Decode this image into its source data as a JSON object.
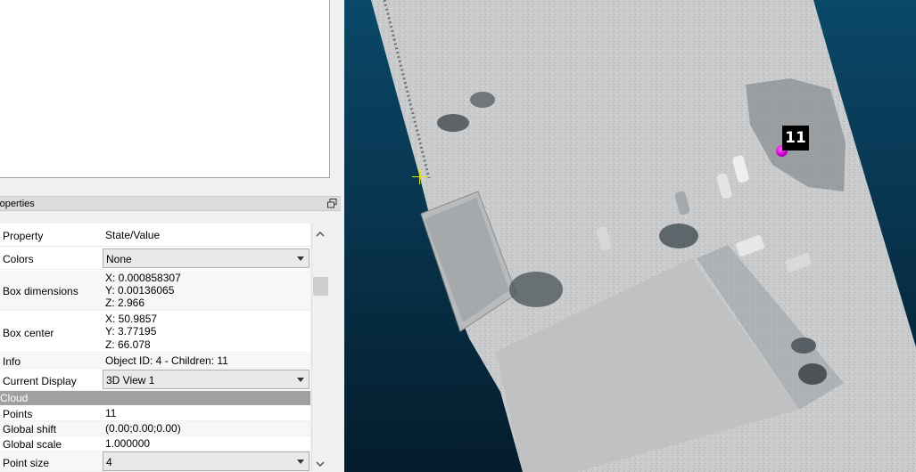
{
  "properties_panel": {
    "title": "Properties",
    "title_visible": "roperties",
    "header": {
      "property": "Property",
      "state_value": "State/Value"
    },
    "rows": {
      "colors": {
        "label": "Colors",
        "value": "None"
      },
      "box_dimensions": {
        "label": "Box dimensions",
        "x": "X: 0.000858307",
        "y": "Y: 0.00136065",
        "z": "Z: 2.966"
      },
      "box_center": {
        "label": "Box center",
        "x": "X: 50.9857",
        "y": "Y: 3.77195",
        "z": "Z: 66.078"
      },
      "info": {
        "label": "Info",
        "value": "Object ID: 4 - Children: 11"
      },
      "current_display": {
        "label": "Current Display",
        "value": "3D View 1"
      },
      "cloud_section": {
        "label": "Cloud"
      },
      "points": {
        "label": "Points",
        "value": "11"
      },
      "global_shift": {
        "label": "Global shift",
        "value": "(0.00;0.00;0.00)"
      },
      "global_scale": {
        "label": "Global scale",
        "value": "1.000000"
      },
      "point_size": {
        "label": "Point size",
        "value": "4"
      }
    }
  },
  "view3d": {
    "point_label": "11",
    "colors": {
      "bg_top": "#0a4868",
      "bg_bottom": "#041c2b",
      "picked_point": "#d000d0",
      "crosshair": "#e8e800"
    }
  }
}
